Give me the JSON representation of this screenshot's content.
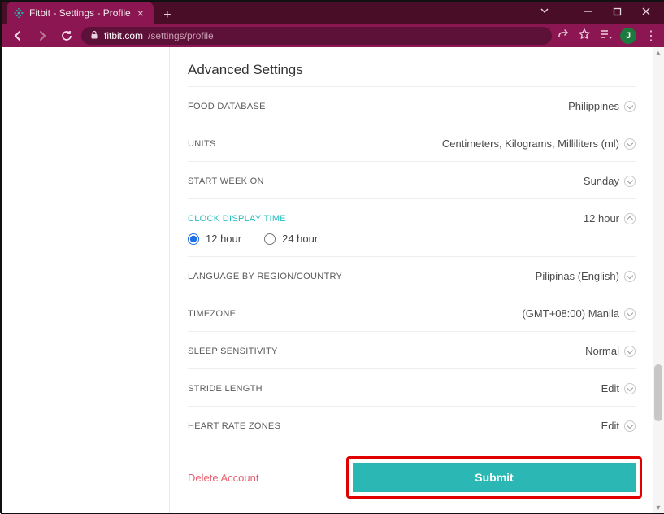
{
  "window": {
    "tab_title": "Fitbit - Settings - Profile",
    "url_host": "fitbit.com",
    "url_path": "/settings/profile",
    "avatar_letter": "J"
  },
  "page": {
    "section_title": "Advanced Settings",
    "rows": {
      "food_db": {
        "label": "FOOD DATABASE",
        "value": "Philippines"
      },
      "units": {
        "label": "UNITS",
        "value": "Centimeters, Kilograms, Milliliters (ml)"
      },
      "start_week": {
        "label": "START WEEK ON",
        "value": "Sunday"
      },
      "clock": {
        "label": "CLOCK DISPLAY TIME",
        "value": "12 hour",
        "options": {
          "a": "12 hour",
          "b": "24 hour"
        },
        "selected": "a"
      },
      "language": {
        "label": "LANGUAGE BY REGION/COUNTRY",
        "value": "Pilipinas (English)"
      },
      "timezone": {
        "label": "TIMEZONE",
        "value": "(GMT+08:00) Manila"
      },
      "sleep": {
        "label": "SLEEP SENSITIVITY",
        "value": "Normal"
      },
      "stride": {
        "label": "STRIDE LENGTH",
        "value": "Edit"
      },
      "hr": {
        "label": "HEART RATE ZONES",
        "value": "Edit"
      }
    },
    "delete_label": "Delete Account",
    "submit_label": "Submit"
  }
}
